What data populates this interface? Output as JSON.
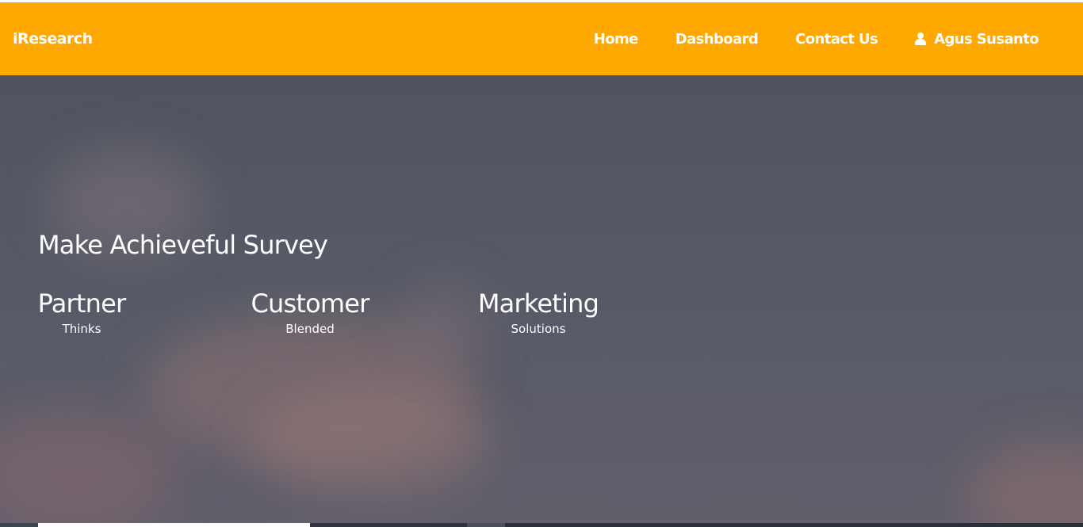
{
  "navbar": {
    "brand": "iResearch",
    "links": [
      {
        "label": "Home"
      },
      {
        "label": "Dashboard"
      },
      {
        "label": "Contact Us"
      }
    ],
    "user": {
      "name": "Agus Susanto",
      "icon": "user-icon"
    }
  },
  "hero": {
    "title": "Make Achieveful Survey",
    "stats": [
      {
        "big": "Partner",
        "small": "Thinks"
      },
      {
        "big": "Customer",
        "small": "Blended"
      },
      {
        "big": "Marketing",
        "small": "Solutions"
      }
    ]
  },
  "colors": {
    "navbar": "#FFA800",
    "text": "#FFFFFF",
    "hero_overlay": "#565A66"
  }
}
